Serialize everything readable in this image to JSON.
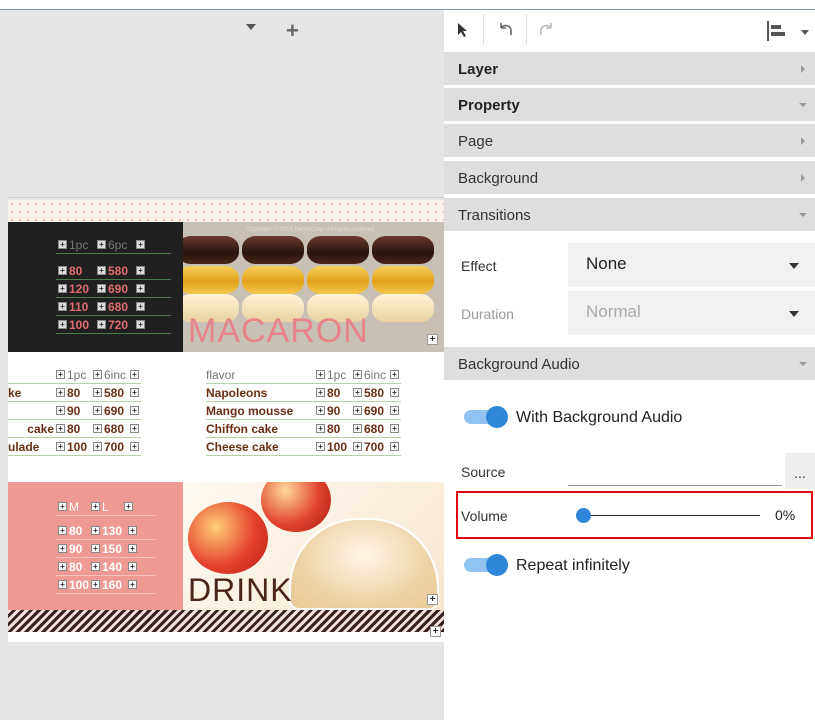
{
  "canvas": {
    "add_label": "+",
    "page": {
      "copyright": "Copyright © 2015 DemoCorp. All rights reserved.",
      "macaron_title": "MACARON",
      "drink_title": "DRINK",
      "table_dark": {
        "header": [
          "1pc",
          "6pc"
        ],
        "rows": [
          [
            "80",
            "580"
          ],
          [
            "120",
            "690"
          ],
          [
            "110",
            "680"
          ],
          [
            "100",
            "720"
          ]
        ]
      },
      "table_white_left": {
        "header": [
          "1pc",
          "6inc"
        ],
        "rows": [
          [
            "ke",
            "80",
            "580"
          ],
          [
            "",
            "90",
            "690"
          ],
          [
            "cake",
            "80",
            "680"
          ],
          [
            "ulade",
            "100",
            "700"
          ]
        ]
      },
      "table_white_right": {
        "header": [
          "flavor",
          "1pc",
          "6inc"
        ],
        "rows": [
          [
            "Napoleons",
            "80",
            "580"
          ],
          [
            "Mango mousse",
            "90",
            "690"
          ],
          [
            "Chiffon cake",
            "80",
            "680"
          ],
          [
            "Cheese cake",
            "100",
            "700"
          ]
        ]
      },
      "table_pink": {
        "header": [
          "M",
          "L"
        ],
        "rows": [
          [
            "80",
            "130"
          ],
          [
            "90",
            "150"
          ],
          [
            "80",
            "140"
          ],
          [
            "100",
            "160"
          ]
        ]
      }
    }
  },
  "panel": {
    "sections": {
      "layer": "Layer",
      "property": "Property",
      "page": "Page",
      "background": "Background",
      "transitions": "Transitions",
      "background_audio": "Background Audio"
    },
    "transitions": {
      "effect_label": "Effect",
      "effect_value": "None",
      "duration_label": "Duration",
      "duration_value": "Normal"
    },
    "audio": {
      "with_audio_label": "With Background Audio",
      "with_audio_on": true,
      "source_label": "Source",
      "browse_label": "...",
      "volume_label": "Volume",
      "volume_value": "0%",
      "volume_level": 0,
      "repeat_label": "Repeat infinitely",
      "repeat_on": true
    }
  },
  "colors": {
    "accent": "#2f86d8",
    "highlight_box": "#e30613",
    "section_bg": "#dedede"
  }
}
